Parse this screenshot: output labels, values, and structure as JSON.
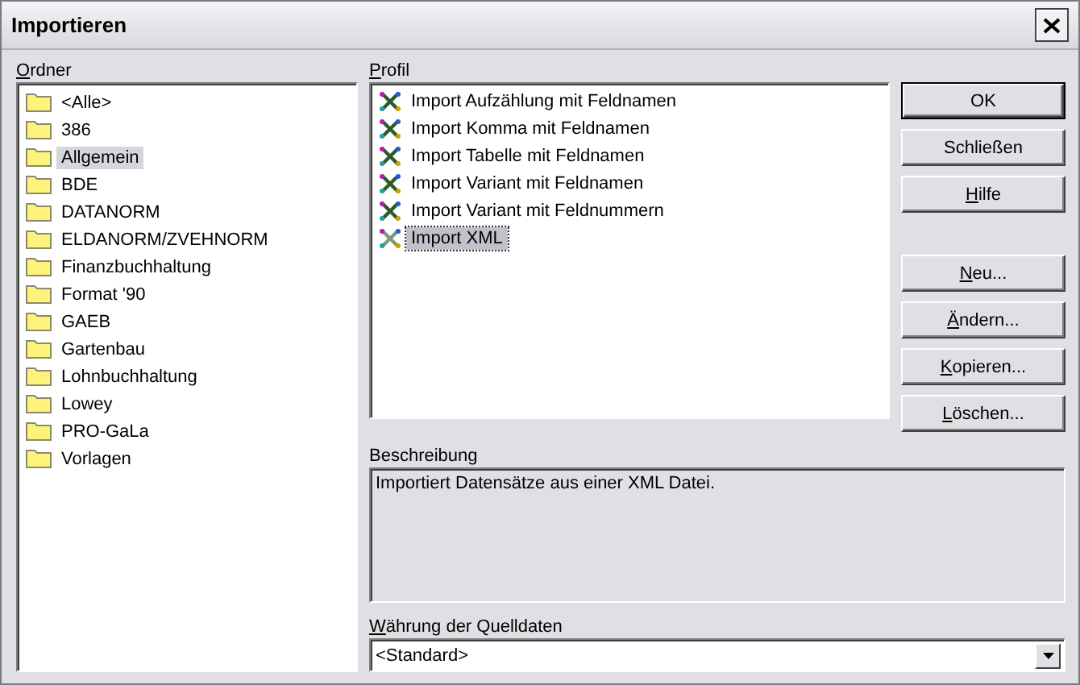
{
  "window": {
    "title": "Importieren"
  },
  "folders": {
    "label": "Ordner",
    "underlined_first": true,
    "items": [
      {
        "name": "<Alle>",
        "selected": false
      },
      {
        "name": "386",
        "selected": false
      },
      {
        "name": "Allgemein",
        "selected": true
      },
      {
        "name": "BDE",
        "selected": false
      },
      {
        "name": "DATANORM",
        "selected": false
      },
      {
        "name": "ELDANORM/ZVEHNORM",
        "selected": false
      },
      {
        "name": "Finanzbuchhaltung",
        "selected": false
      },
      {
        "name": "Format '90",
        "selected": false
      },
      {
        "name": "GAEB",
        "selected": false
      },
      {
        "name": "Gartenbau",
        "selected": false
      },
      {
        "name": "Lohnbuchhaltung",
        "selected": false
      },
      {
        "name": "Lowey",
        "selected": false
      },
      {
        "name": "PRO-GaLa",
        "selected": false
      },
      {
        "name": "Vorlagen",
        "selected": false
      }
    ]
  },
  "profiles": {
    "label": "Profil",
    "underlined_first": true,
    "items": [
      {
        "name": "Import Aufzählung mit Feldnamen",
        "selected": false
      },
      {
        "name": "Import Komma mit Feldnamen",
        "selected": false
      },
      {
        "name": "Import Tabelle mit Feldnamen",
        "selected": false
      },
      {
        "name": "Import Variant mit Feldnamen",
        "selected": false
      },
      {
        "name": "Import Variant mit Feldnummern",
        "selected": false
      },
      {
        "name": "Import XML",
        "selected": true
      }
    ]
  },
  "buttons": [
    {
      "label": "OK",
      "underlined_first": false,
      "default": true
    },
    {
      "label": "Schließen",
      "underlined_first": false,
      "default": false
    },
    {
      "label": "Hilfe",
      "underlined_first": true,
      "default": false
    }
  ],
  "profile_buttons": [
    {
      "label": "Neu...",
      "underlined_first": true
    },
    {
      "label": "Ändern...",
      "underlined_first": true
    },
    {
      "label": "Kopieren...",
      "underlined_first": true
    },
    {
      "label": "Löschen...",
      "underlined_first": true
    }
  ],
  "description": {
    "label": "Beschreibung",
    "text": "Importiert Datensätze aus einer XML Datei."
  },
  "currency": {
    "label": "Währung der Quelldaten",
    "underlined_first": true,
    "value": "<Standard>"
  }
}
